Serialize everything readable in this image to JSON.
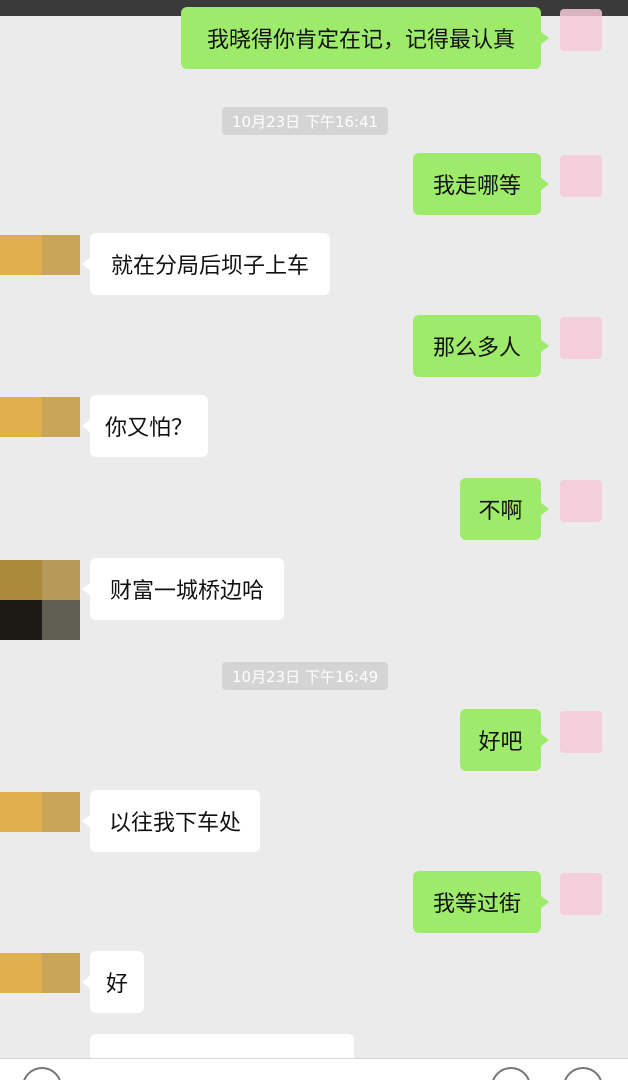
{
  "messages": [
    {
      "side": "sent",
      "text": "我晓得你肯定在记，记得最认真"
    },
    {
      "side": "sent",
      "text": "我走哪等"
    },
    {
      "side": "received",
      "text": "就在分局后坝子上车"
    },
    {
      "side": "sent",
      "text": "那么多人"
    },
    {
      "side": "received",
      "text": "你又怕？"
    },
    {
      "side": "sent",
      "text": "不啊"
    },
    {
      "side": "received",
      "text": "财富一城桥边哈"
    },
    {
      "side": "sent",
      "text": "好吧"
    },
    {
      "side": "received",
      "text": "以往我下车处"
    },
    {
      "side": "sent",
      "text": "我等过街"
    },
    {
      "side": "received",
      "text": "好"
    }
  ],
  "timestamps": [
    "10月23日 下午16:41",
    "10月23日 下午16:49"
  ],
  "colors": {
    "background": "#ebebeb",
    "sent_bubble": "#9eea6a",
    "received_bubble": "#ffffff",
    "timestamp_chip": "#d4d4d4"
  },
  "icons": [
    "voice-toggle-icon",
    "emoji-icon",
    "more-plus-icon"
  ]
}
